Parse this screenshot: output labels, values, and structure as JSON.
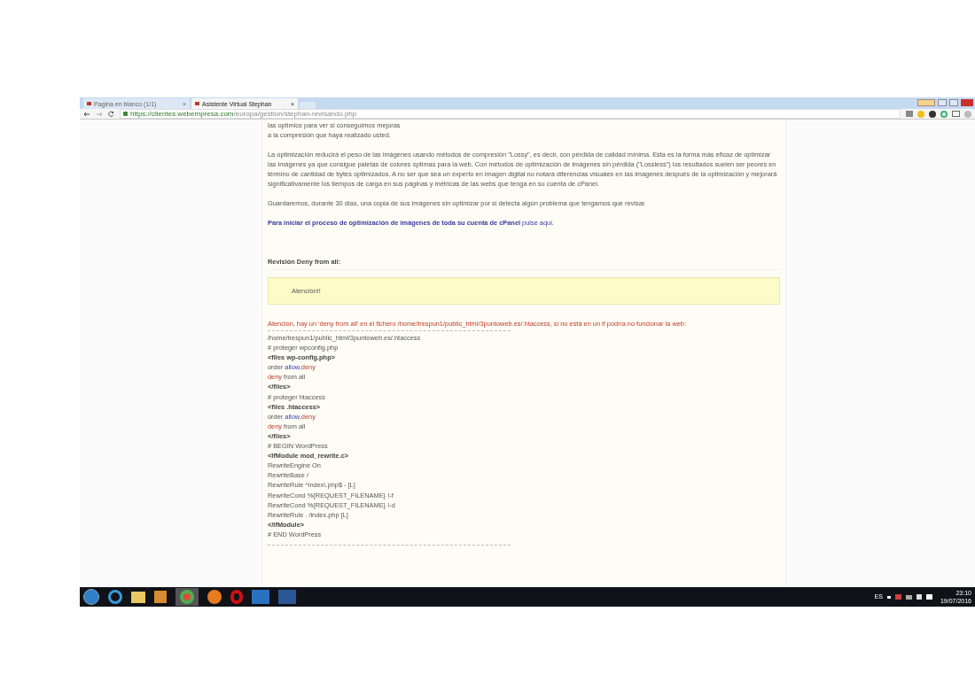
{
  "browser": {
    "tabs": [
      {
        "title": "Pagina en blanco (1/1)",
        "close": "×",
        "selected": false
      },
      {
        "title": "Asistente Virtual Stephan",
        "close": "×",
        "selected": true
      }
    ],
    "address": {
      "host": "https://clientes.webempresa.com",
      "path": "/europa/gestion/stephan-revisando.php"
    }
  },
  "content": {
    "intro_lines": [
      "las optimice para ver si conseguimos mejoras",
      "a la compresión que haya realizado usted."
    ],
    "paragraphs": [
      "La optimización reducirá el peso de las imágenes usando métodos de compresión \"Lossy\", es decir, con pérdida de calidad mínima. Esta es la forma más eficaz de optimizar las imágenes ya que consigue paletas de colores óptimas para la web. Con métodos de optimización de imágenes sin pérdida (\"Lossless\") los resultados suelen ser peores en término de cantidad de bytes optimizados. A no ser que sea un experto en imagen digital no notará diferencias visuales en las imagenes después de la optimización y mejorará significativamente los tiempos de carga en sus páginas y métricas de las webs que tenga en su cuenta de cPanel.",
      "Guardaremos, durante 30 días, una copia de sus imágenes sin optimizar por si detecta algún problema que tengamos que revisar."
    ],
    "cta": {
      "text": "Para iniciar el proceso de optimización de imágenes de toda su cuenta de cPanel",
      "link": "pulse aqui."
    },
    "section_title": "Revisión Deny from all:",
    "alert": "Atención!!",
    "warning": "Atención, hay un 'deny from all' en el fichero /home/trespun1/public_html/3puntoweb.es/.htaccess, si no está en un if podría no funcionar la web:",
    "code_lines": [
      [
        {
          "text": "/home/trespun1/public_html/3puntoweb.es/.htaccess",
          "kind": "plain"
        }
      ],
      [
        {
          "text": "# proteger wpconfig.php",
          "kind": "plain"
        }
      ],
      [
        {
          "text": "<files wp-config.php>",
          "kind": "tag"
        }
      ],
      [
        {
          "text": "order ",
          "kind": "plain"
        },
        {
          "text": "allow,",
          "kind": "allow"
        },
        {
          "text": "deny",
          "kind": "deny"
        }
      ],
      [
        {
          "text": "deny",
          "kind": "deny"
        },
        {
          "text": " from all",
          "kind": "plain"
        }
      ],
      [
        {
          "text": "</files>",
          "kind": "tag"
        }
      ],
      [
        {
          "text": "# proteger htaccess",
          "kind": "plain"
        }
      ],
      [
        {
          "text": "<files .htaccess>",
          "kind": "tag"
        }
      ],
      [
        {
          "text": "order ",
          "kind": "plain"
        },
        {
          "text": "allow,",
          "kind": "allow"
        },
        {
          "text": "deny",
          "kind": "deny"
        }
      ],
      [
        {
          "text": "deny",
          "kind": "deny"
        },
        {
          "text": " from all",
          "kind": "plain"
        }
      ],
      [
        {
          "text": "</files>",
          "kind": "tag"
        }
      ],
      [
        {
          "text": "# BEGIN WordPress",
          "kind": "plain"
        }
      ],
      [
        {
          "text": "<IfModule mod_rewrite.c>",
          "kind": "tag"
        }
      ],
      [
        {
          "text": "RewriteEngine On",
          "kind": "plain"
        }
      ],
      [
        {
          "text": "RewriteBase /",
          "kind": "plain"
        }
      ],
      [
        {
          "text": "RewriteRule ^index\\.php$ - [L]",
          "kind": "plain"
        }
      ],
      [
        {
          "text": "RewriteCond %{REQUEST_FILENAME} !-f",
          "kind": "plain"
        }
      ],
      [
        {
          "text": "RewriteCond %{REQUEST_FILENAME} !-d",
          "kind": "plain"
        }
      ],
      [
        {
          "text": "RewriteRule . /index.php [L]",
          "kind": "plain"
        }
      ],
      [
        {
          "text": "</IfModule>",
          "kind": "tag"
        }
      ],
      [
        {
          "text": "# END WordPress",
          "kind": "plain"
        }
      ]
    ]
  },
  "taskbar": {
    "language": "ES",
    "time": "23:10",
    "date": "19/07/2016"
  }
}
